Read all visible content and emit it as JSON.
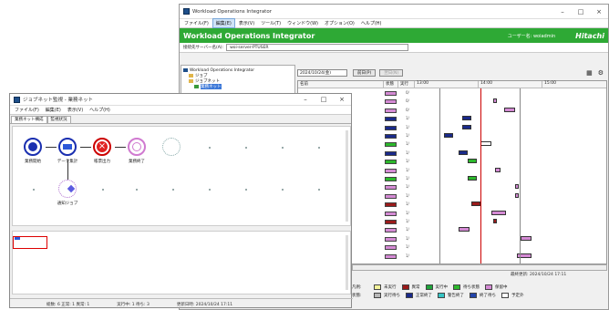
{
  "main": {
    "title": "Workload Operations Integrator",
    "menu": [
      "ファイル(F)",
      "編集(E)",
      "表示(V)",
      "ツール(T)",
      "ウィンドウ(W)",
      "オプション(O)",
      "ヘルプ(H)"
    ],
    "banner_title": "Workload Operations Integrator",
    "banner_user": "ユーザー名: woiadmin",
    "banner_logo": "Hitachi",
    "address_label": "接続先サーバー名(A):",
    "address_value": "woi-server-PTUSER",
    "tree": [
      {
        "label": "Workload Operations Integrator",
        "icon": "server-icon"
      },
      {
        "label": "ジョブ",
        "icon": "folder-icon"
      },
      {
        "label": "ジョブネット",
        "icon": "folder-icon"
      },
      {
        "label": "業務ネット",
        "icon": "jobnet-icon",
        "selected": true
      }
    ],
    "toolbar": {
      "dropdown": "2024/10/24(金)",
      "btn1": "前日(P)",
      "btn2": "翌日(N)"
    },
    "grid_headers": [
      "名前",
      "状態",
      "実行",
      "13:00",
      "14:00",
      "15:00"
    ],
    "status_text": "最終更新: 2024/10/24 17:11",
    "legend": {
      "row1_label": "凡例:",
      "row2_label": "状態:",
      "row1": [
        {
          "label": "未実行",
          "color": "#f3f39a"
        },
        {
          "label": "異常",
          "color": "#9b1b1b"
        },
        {
          "label": "実行中",
          "color": "#1fa33a"
        },
        {
          "label": "待ち状態",
          "color": "#2cb82c"
        },
        {
          "label": "保留中",
          "color": "#d48ad4"
        }
      ],
      "row2": [
        {
          "label": "実行待ち",
          "color": "#b8b8b8"
        },
        {
          "label": "正常終了",
          "color": "#1a2a8a"
        },
        {
          "label": "警告終了",
          "color": "#36c4c4"
        },
        {
          "label": "終了待ち",
          "color": "#2244aa"
        },
        {
          "label": "予定外",
          "color": "#ffffff"
        }
      ]
    },
    "rows": [
      {
        "s": "#d48ad4",
        "t": "0/"
      },
      {
        "s": "#d48ad4",
        "t": "0/"
      },
      {
        "s": "#d48ad4",
        "t": "0/"
      },
      {
        "s": "#1a2a8a",
        "t": "1/"
      },
      {
        "s": "#1a2a8a",
        "t": "1/"
      },
      {
        "s": "#1a2a8a",
        "t": "1/"
      },
      {
        "s": "#2cb82c",
        "t": "1/"
      },
      {
        "s": "#1a2a8a",
        "t": "1/"
      },
      {
        "s": "#2cb82c",
        "t": "1/"
      },
      {
        "s": "#d48ad4",
        "t": "1/"
      },
      {
        "s": "#2cb82c",
        "t": "1/"
      },
      {
        "s": "#d48ad4",
        "t": "1/"
      },
      {
        "s": "#d48ad4",
        "t": "1/"
      },
      {
        "s": "#9b1b1b",
        "t": "1/"
      },
      {
        "s": "#d48ad4",
        "t": "1/"
      },
      {
        "s": "#9b1b1b",
        "t": "1/"
      },
      {
        "s": "#d48ad4",
        "t": "1/"
      },
      {
        "s": "#d48ad4",
        "t": "1/"
      },
      {
        "s": "#d48ad4",
        "t": "1/"
      },
      {
        "s": "#d48ad4",
        "t": "1/"
      }
    ]
  },
  "sub": {
    "title": "ジョブネット監視 - 業務ネット",
    "menu": [
      "ファイル(F)",
      "編集(E)",
      "表示(V)",
      "ヘルプ(H)"
    ],
    "tabs": [
      "業務ネット構成",
      "監視状況"
    ],
    "nodes": [
      {
        "label": "業務開始",
        "icon": "start-node-icon"
      },
      {
        "label": "データ集計",
        "icon": "job-running-icon"
      },
      {
        "label": "帳票出力",
        "icon": "job-error-icon"
      },
      {
        "label": "業務終了",
        "icon": "end-node-icon"
      },
      {
        "label": "",
        "icon": "pending-node-icon"
      },
      {
        "label": "通知ジョブ",
        "icon": "notify-node-icon"
      }
    ],
    "status": [
      "総数: 6 正常: 1 異常: 1",
      "実行中: 1 待ち: 3",
      "更新日時: 2024/10/24 17:11"
    ]
  }
}
